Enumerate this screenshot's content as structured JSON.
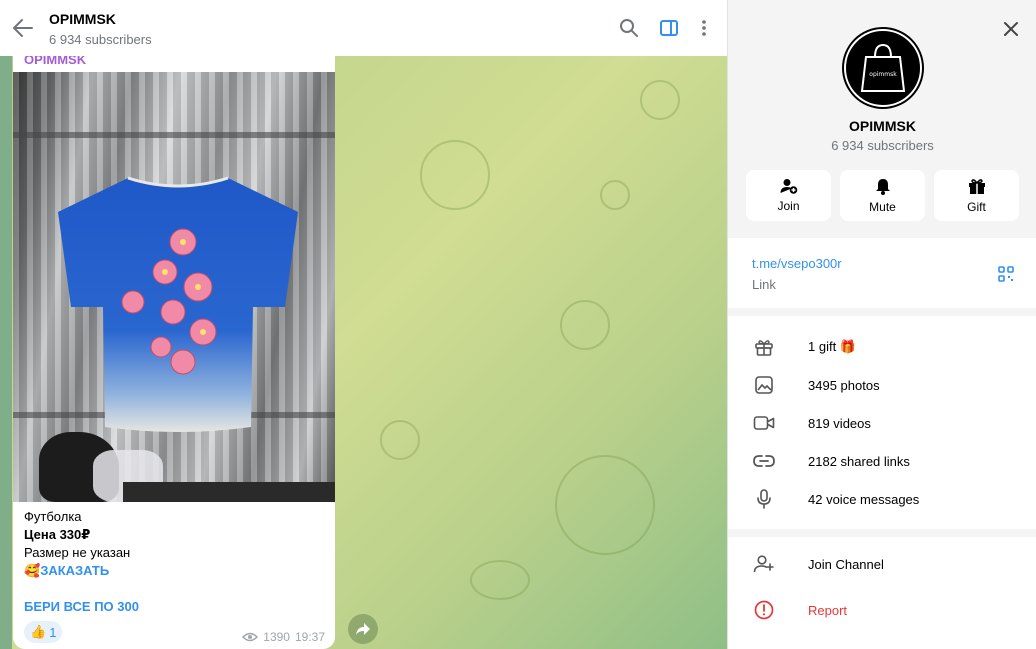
{
  "header": {
    "title": "OPIMMSK",
    "subscribers": "6 934 subscribers"
  },
  "message": {
    "sender": "OPIMMSK",
    "line1": "Футболка",
    "line2": "Цена 330₽",
    "line3": "Размер не указан",
    "order_emoji": "🥰",
    "order_label": "ЗАКАЗАТЬ",
    "promo": "БЕРИ ВСЕ ПО 300",
    "reaction_emoji": "👍",
    "reaction_count": "1",
    "views": "1390",
    "time": "19:37"
  },
  "panel": {
    "title": "OPIMMSK",
    "subscribers": "6 934 subscribers",
    "avatar_text": "opimmsk",
    "actions": [
      {
        "label": "Join",
        "icon": "add-user-icon"
      },
      {
        "label": "Mute",
        "icon": "bell-icon"
      },
      {
        "label": "Gift",
        "icon": "gift-icon"
      }
    ],
    "link": {
      "value": "t.me/vsepo300r",
      "label": "Link"
    },
    "media": [
      {
        "label": "1 gift 🎁",
        "icon": "gift-icon"
      },
      {
        "label": "3495 photos",
        "icon": "photo-icon"
      },
      {
        "label": "819 videos",
        "icon": "video-icon"
      },
      {
        "label": "2182 shared links",
        "icon": "link-icon"
      },
      {
        "label": "42 voice messages",
        "icon": "microphone-icon"
      }
    ],
    "join_label": "Join Channel",
    "report_label": "Report"
  },
  "colors": {
    "accent": "#3390ec",
    "danger": "#e53935",
    "sender": "#a35bd6"
  }
}
